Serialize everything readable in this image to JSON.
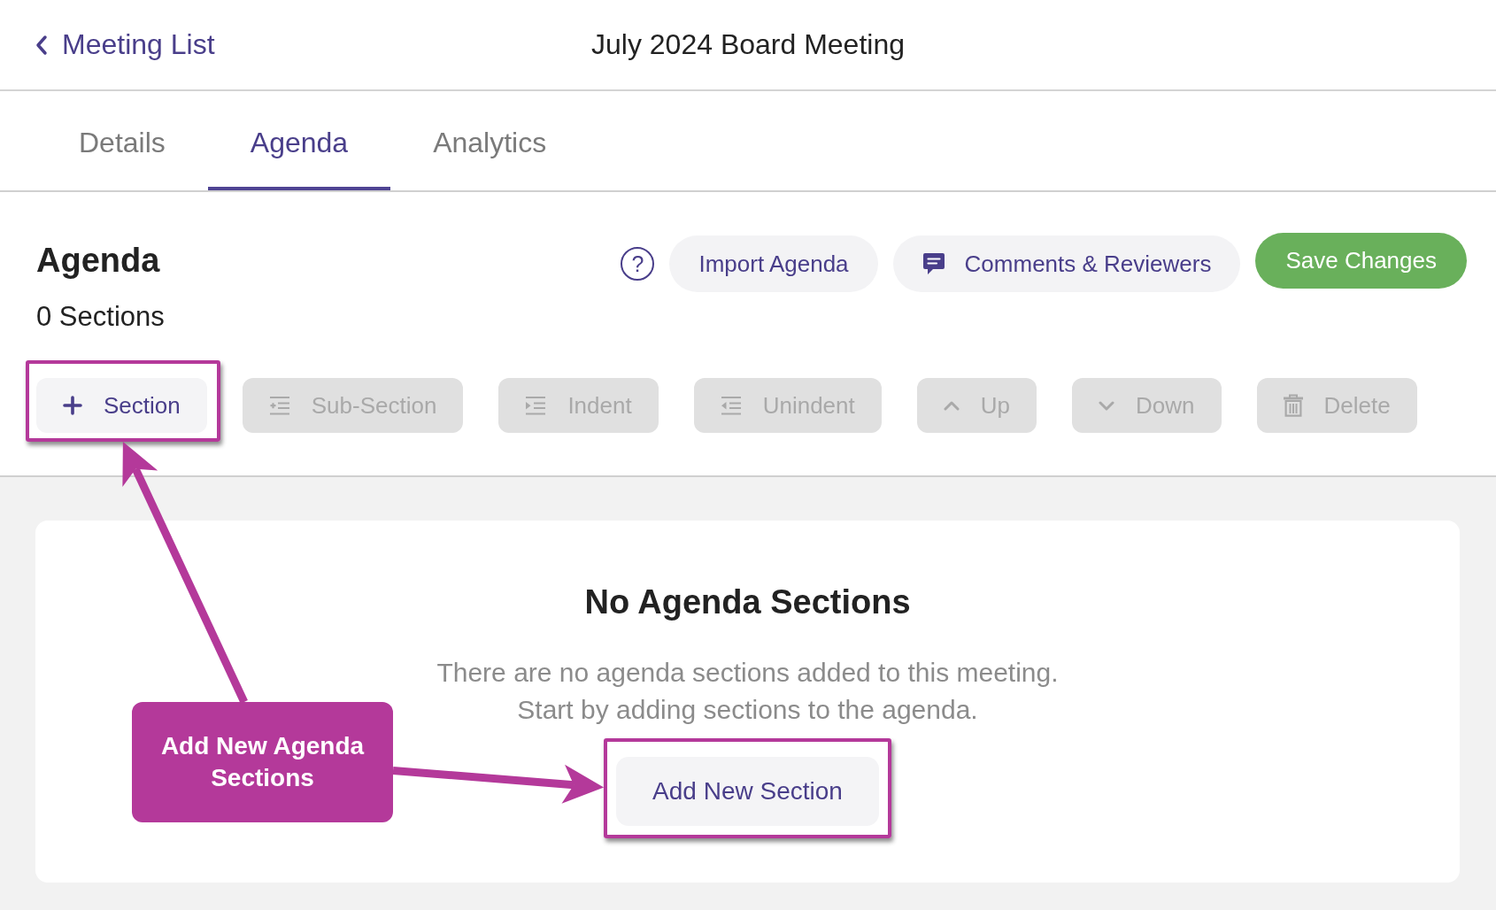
{
  "header": {
    "back_link": "Meeting List",
    "title": "July 2024 Board Meeting"
  },
  "tabs": [
    {
      "label": "Details",
      "selected": false
    },
    {
      "label": "Agenda",
      "selected": true
    },
    {
      "label": "Analytics",
      "selected": false
    }
  ],
  "agenda": {
    "heading": "Agenda",
    "section_count": "0 Sections",
    "actions": [
      {
        "kind": "help",
        "label": "?"
      },
      {
        "kind": "secondary",
        "label": "Import Agenda"
      },
      {
        "kind": "secondary",
        "label": "Comments & Reviewers"
      },
      {
        "kind": "primary",
        "label": "Save Changes"
      }
    ],
    "toolbar": [
      {
        "label": "Section",
        "disabled": false,
        "highlighted": true
      },
      {
        "label": "Sub-Section",
        "disabled": true,
        "highlighted": false
      },
      {
        "label": "Indent",
        "disabled": true,
        "highlighted": false
      },
      {
        "label": "Unindent",
        "disabled": true,
        "highlighted": false
      },
      {
        "label": "Up",
        "disabled": true,
        "highlighted": false
      },
      {
        "label": "Down",
        "disabled": true,
        "highlighted": false
      },
      {
        "label": "Delete",
        "disabled": true,
        "highlighted": false
      }
    ]
  },
  "empty_state": {
    "title": "No Agenda Sections",
    "description": [
      "There are no agenda sections added to this meeting.",
      "Start by adding sections to the agenda."
    ],
    "add_button": {
      "label": "Add New Section",
      "highlighted": true
    }
  },
  "annotation": {
    "callout": "Add New Agenda Sections"
  }
}
